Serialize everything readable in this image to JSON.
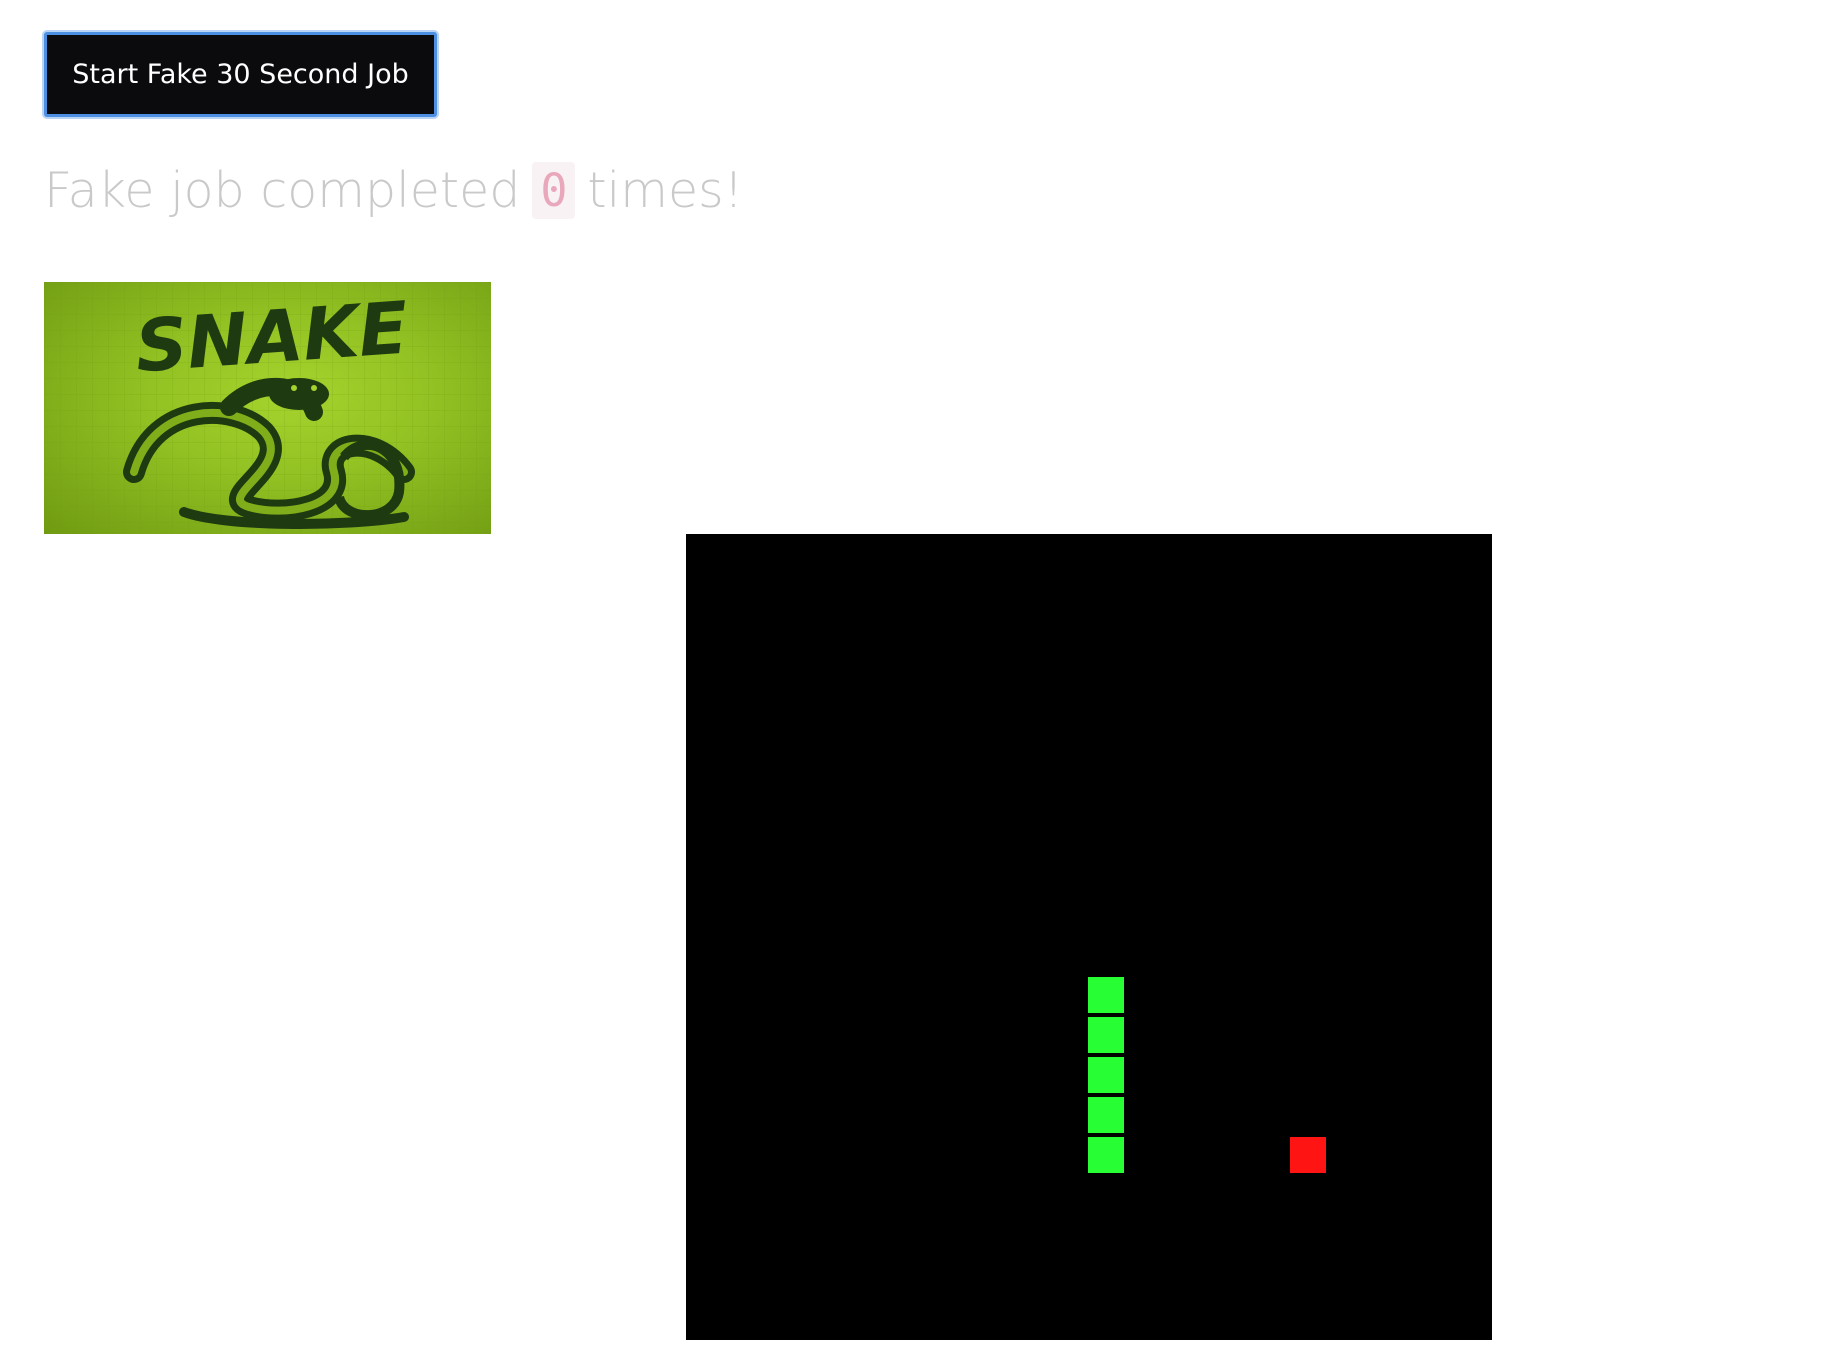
{
  "job": {
    "button_label": "Start Fake 30 Second Job",
    "status_prefix": "Fake job completed",
    "completed_count": "0",
    "status_suffix": "times!"
  },
  "logo": {
    "text": "SNAKE",
    "colors": {
      "background": "#96c424",
      "ink": "#1e3a10"
    }
  },
  "game": {
    "colors": {
      "board": "#000000",
      "snake": "#27ff34",
      "food": "#ff1414"
    },
    "snake_length": 5,
    "snake_direction": "vertical",
    "food_count": 1
  }
}
